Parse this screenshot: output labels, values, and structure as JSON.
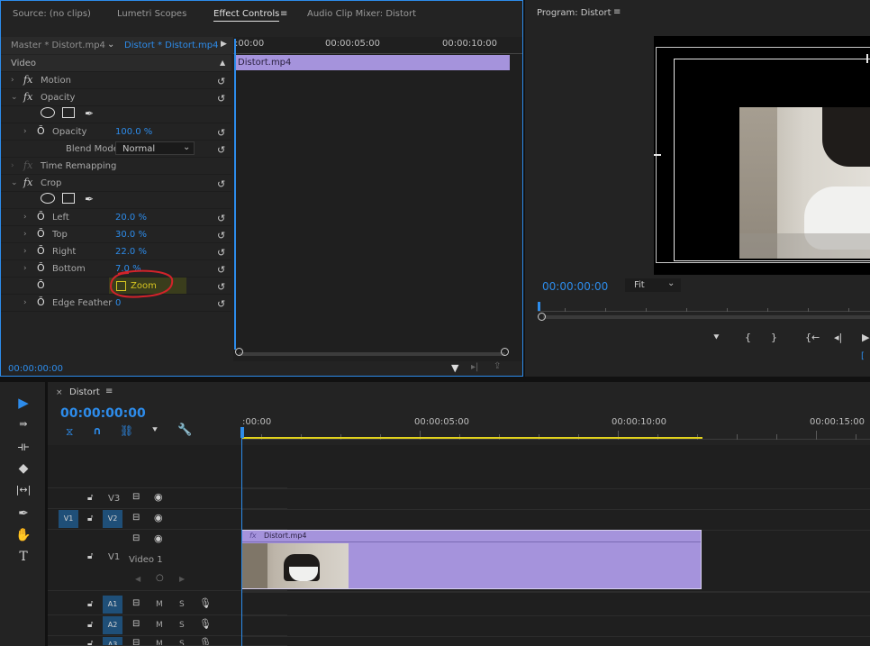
{
  "effect_panel": {
    "tabs": [
      "Source: (no clips)",
      "Lumetri Scopes",
      "Effect Controls",
      "Audio Clip Mixer: Distort"
    ],
    "menu_icon": "hamburger-icon",
    "master_label": "Master * Distort.mp4",
    "clip_label": "Distort * Distort.mp4",
    "ruler_times": [
      ":00:00",
      "00:00:05:00",
      "00:00:10:00"
    ],
    "clip_name": "Distort.mp4",
    "section_video": "Video",
    "motion": "Motion",
    "opacity_group": "Opacity",
    "opacity_label": "Opacity",
    "opacity_value": "100.0 %",
    "blend_label": "Blend Mode",
    "blend_value": "Normal",
    "time_remap": "Time Remapping",
    "crop": "Crop",
    "left_label": "Left",
    "left_value": "20.0 %",
    "top_label": "Top",
    "top_value": "30.0 %",
    "right_label": "Right",
    "right_value": "22.0 %",
    "bottom_label": "Bottom",
    "bottom_value": "7.0 %",
    "zoom_label": "Zoom",
    "edge_label": "Edge Feather",
    "edge_value": "0",
    "timecode": "00:00:00:00"
  },
  "program_panel": {
    "title": "Program: Distort",
    "menu_icon": "hamburger-icon",
    "timecode": "00:00:00:00",
    "fit": "Fit"
  },
  "timeline": {
    "seq_name": "Distort",
    "timecode": "00:00:00:00",
    "ruler_times": [
      ":00:00",
      "00:00:05:00",
      "00:00:10:00",
      "00:00:15:00"
    ],
    "tracks": {
      "v3": "V3",
      "v2": "V2",
      "v1": "V1",
      "v1_source": "V1",
      "video1": "Video 1",
      "a1": "A1",
      "a2": "A2",
      "a3": "A3",
      "mute": "M",
      "solo": "S"
    },
    "clip_name": "Distort.mp4",
    "clip_fx": "fx"
  },
  "colors": {
    "accent": "#2d8ceb",
    "clip_purple": "#a593dc",
    "work_area": "#e2d21c",
    "annotation": "#d2232a"
  }
}
